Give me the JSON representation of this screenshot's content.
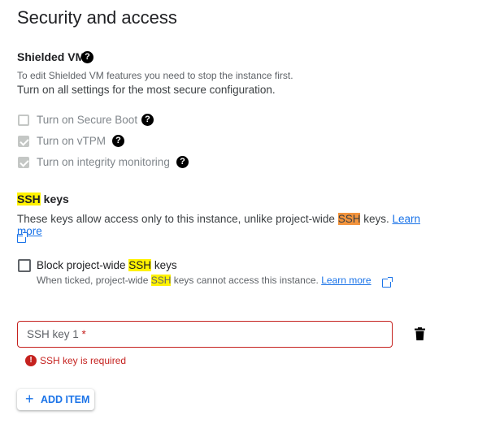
{
  "section_title": "Security and access",
  "shielded_vm": {
    "heading": "Shielded VM",
    "help_glyph": "?",
    "desc_line1": "To edit Shielded VM features you need to stop the instance first.",
    "desc_line2": "Turn on all settings for the most secure configuration.",
    "options": [
      {
        "label": "Turn on Secure Boot",
        "checked": false
      },
      {
        "label": "Turn on vTPM",
        "checked": true
      },
      {
        "label": "Turn on integrity monitoring",
        "checked": true
      }
    ]
  },
  "ssh_keys": {
    "heading_hl": "SSH",
    "heading_rest": " keys",
    "desc_before": "These keys allow access only to this instance, unlike project-wide ",
    "desc_hl": "SSH",
    "desc_after": " keys. ",
    "learn_more": "Learn more",
    "block": {
      "label_before": "Block project-wide ",
      "label_hl": "SSH",
      "label_after": " keys",
      "sub_before": "When ticked, project-wide ",
      "sub_hl": "SSH",
      "sub_after": " keys cannot access this instance. ",
      "learn_more": "Learn more",
      "checked": false
    },
    "field": {
      "label": "SSH key 1",
      "required_mark": "*",
      "value": ""
    },
    "error": {
      "icon_glyph": "!",
      "text": "SSH key is required"
    },
    "add_button": {
      "plus": "+",
      "label": "ADD ITEM"
    }
  },
  "colors": {
    "accent": "#1a73e8",
    "error": "#c5221f",
    "highlight_yellow": "#fff200",
    "highlight_orange": "#f3943d"
  }
}
